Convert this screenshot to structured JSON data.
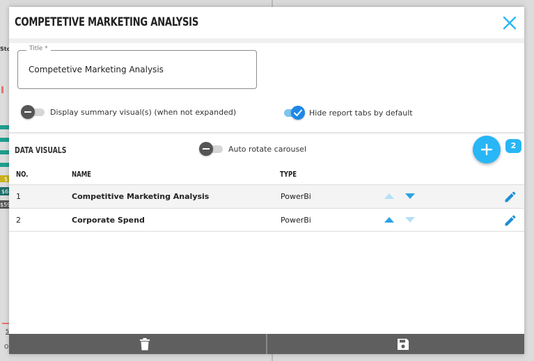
{
  "background": {
    "fragments": [
      "Sto",
      "$",
      "$6",
      "$59",
      "5",
      "O"
    ]
  },
  "dialog": {
    "title": "COMPETETIVE MARKETING ANALYSIS",
    "close_icon": "close-icon"
  },
  "title_field": {
    "label": "Title",
    "required_mark": "*",
    "value": "Competetive Marketing Analysis"
  },
  "toggles": {
    "summary": {
      "label": "Display summary visual(s) (when not expanded)",
      "on": false
    },
    "hide_tabs": {
      "label": "Hide report tabs by default",
      "on": true
    },
    "auto_rotate": {
      "label": "Auto rotate carousel",
      "on": false
    }
  },
  "data_visuals": {
    "title": "DATA VISUALS",
    "count": "2",
    "add_icon": "plus-icon",
    "columns": {
      "no": "NO.",
      "name": "NAME",
      "type": "TYPE"
    },
    "rows": [
      {
        "no": "1",
        "name": "Competitive Marketing Analysis",
        "type": "PowerBi"
      },
      {
        "no": "2",
        "name": "Corporate Spend",
        "type": "PowerBi"
      }
    ]
  },
  "footer": {
    "delete_icon": "trash-icon",
    "save_icon": "save-icon"
  },
  "colors": {
    "accent": "#29b6f6",
    "toggle_on": "#1e88e5",
    "footer": "#5f5f5f"
  }
}
